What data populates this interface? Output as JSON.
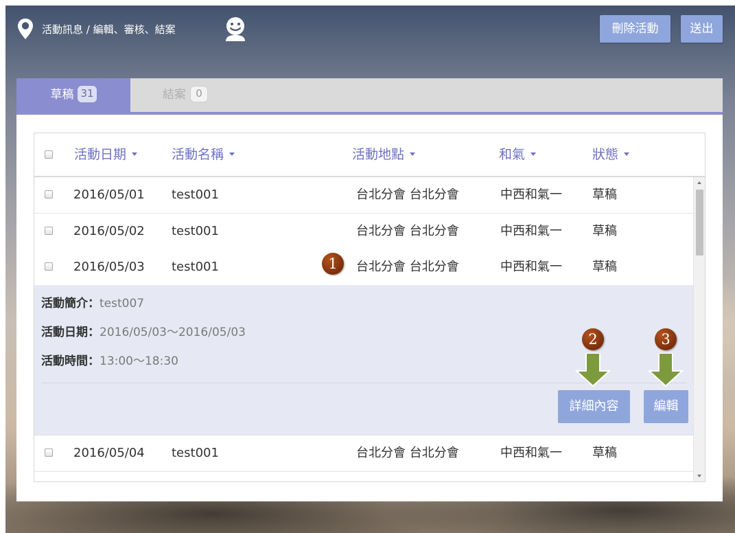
{
  "header": {
    "breadcrumb": "活動訊息 / 編輯、審核、結案",
    "pin_icon": "map-pin-icon",
    "avatar_icon": "smiley-user-icon",
    "delete_label": "刪除活動",
    "logout_label": "送出"
  },
  "tabs": [
    {
      "label": "草稿",
      "count": "31",
      "active": true
    },
    {
      "label": "結案",
      "count": "0",
      "active": false
    }
  ],
  "table": {
    "columns": [
      "活動日期",
      "活動名稱",
      "活動地點",
      "和氣",
      "狀態"
    ],
    "rows": [
      {
        "date": "2016/05/01",
        "name": "test001",
        "place": "台北分會 台北分會",
        "hq": "中西和氣一",
        "status": "草稿"
      },
      {
        "date": "2016/05/02",
        "name": "test001",
        "place": "台北分會 台北分會",
        "hq": "中西和氣一",
        "status": "草稿"
      },
      {
        "date": "2016/05/03",
        "name": "test001",
        "place": "台北分會 台北分會",
        "hq": "中西和氣一",
        "status": "草稿"
      },
      {
        "date": "2016/05/04",
        "name": "test001",
        "place": "台北分會 台北分會",
        "hq": "中西和氣一",
        "status": "草稿"
      }
    ]
  },
  "detail": {
    "intro_label": "活動簡介：",
    "intro_value": "test007",
    "date_label": "活動日期：",
    "date_value": "2016/05/03～2016/05/03",
    "time_label": "活動時間：",
    "time_value": "13:00～18:30",
    "details_button": "詳細內容",
    "edit_button": "編輯"
  },
  "markers": [
    "1",
    "2",
    "3"
  ],
  "colors": {
    "accent": "#8a8dd0",
    "button": "#8fa6dc",
    "header_text": "#6f72c0",
    "detail_bg": "#e6e9f4",
    "marker": "#8b3a12",
    "arrow": "#7d9a3c"
  }
}
